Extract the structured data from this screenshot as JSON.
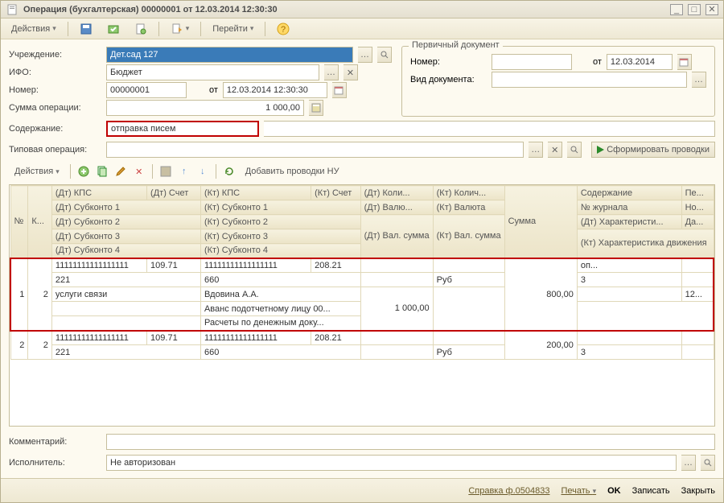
{
  "title": "Операция (бухгалтерская) 00000001 от 12.03.2014 12:30:30",
  "toolbar": {
    "actions": "Действия",
    "goto": "Перейти"
  },
  "form": {
    "institution_label": "Учреждение:",
    "institution": "Дет.сад 127",
    "ifo_label": "ИФО:",
    "ifo": "Бюджет",
    "number_label": "Номер:",
    "number": "00000001",
    "date_from_label": "от",
    "date": "12.03.2014 12:30:30",
    "sum_label": "Сумма операции:",
    "sum": "1 000,00",
    "content_label": "Содержание:",
    "content": "отправка писем",
    "typop_label": "Типовая операция:",
    "generate": "Сформировать проводки"
  },
  "primary_doc": {
    "legend": "Первичный документ",
    "number_label": "Номер:",
    "from_label": "от",
    "date": "12.03.2014",
    "kind_label": "Вид документа:"
  },
  "subtoolbar": {
    "actions": "Действия",
    "add_nu": "Добавить проводки НУ"
  },
  "grid": {
    "headers": {
      "no": "№",
      "k": "К...",
      "dt_kps": "(Дт) КПС",
      "dt_acct": "(Дт) Счет",
      "kt_kps": "(Кт) КПС",
      "kt_acct": "(Кт) Счет",
      "dt_qty": "(Дт) Коли...",
      "kt_qty": "(Кт) Колич...",
      "sum": "Сумма",
      "content": "Содержание",
      "per": "Пе..."
    },
    "subheaders": {
      "dt_sub1": "(Дт) Субконто 1",
      "kt_sub1": "(Кт) Субконто 1",
      "dt_sub2": "(Дт) Субконто 2",
      "kt_sub2": "(Кт) Субконто 2",
      "dt_sub3": "(Дт) Субконто 3",
      "kt_sub3": "(Кт) Субконто 3",
      "dt_sub4": "(Дт) Субконто 4",
      "kt_sub4": "(Кт) Субконто 4",
      "dt_cur": "(Дт) Валю...",
      "kt_cur": "(Кт) Валюта",
      "dt_cur_sum": "(Дт) Вал. сумма",
      "kt_cur_sum": "(Кт) Вал. сумма",
      "journal": "№ журнала",
      "no2": "Но...",
      "dt_char": "(Дт) Характеристи...",
      "da": "Да...",
      "kt_char": "(Кт) Характеристика движения"
    },
    "rows": [
      {
        "no": "1",
        "k": "2",
        "dt_kps": "11111111111111111",
        "dt_acct": "109.71",
        "kt_kps": "11111111111111111",
        "kt_acct": "208.21",
        "sum": "800,00",
        "content": "оп...",
        "sub_dt1": "221",
        "sub_kt1": "660",
        "kt_cur": "Руб",
        "journal": "3",
        "sub_dt2": "услуги связи",
        "sub_kt2": "Вдовина А.А.",
        "dt_cur_sum": "1 000,00",
        "per": "12...",
        "sub_kt3": "Аванс подотчетному лицу 00...",
        "sub_kt4": "Расчеты по денежным доку..."
      },
      {
        "no": "2",
        "k": "2",
        "dt_kps": "11111111111111111",
        "dt_acct": "109.71",
        "kt_kps": "11111111111111111",
        "kt_acct": "208.21",
        "sum": "200,00",
        "sub_dt1": "221",
        "sub_kt1": "660",
        "kt_cur": "Руб",
        "journal": "3"
      }
    ]
  },
  "bottom": {
    "comment_label": "Комментарий:",
    "executor_label": "Исполнитель:",
    "executor": "Не авторизован"
  },
  "footer": {
    "report": "Справка ф.0504833",
    "print": "Печать",
    "ok": "OK",
    "save": "Записать",
    "close": "Закрыть"
  }
}
